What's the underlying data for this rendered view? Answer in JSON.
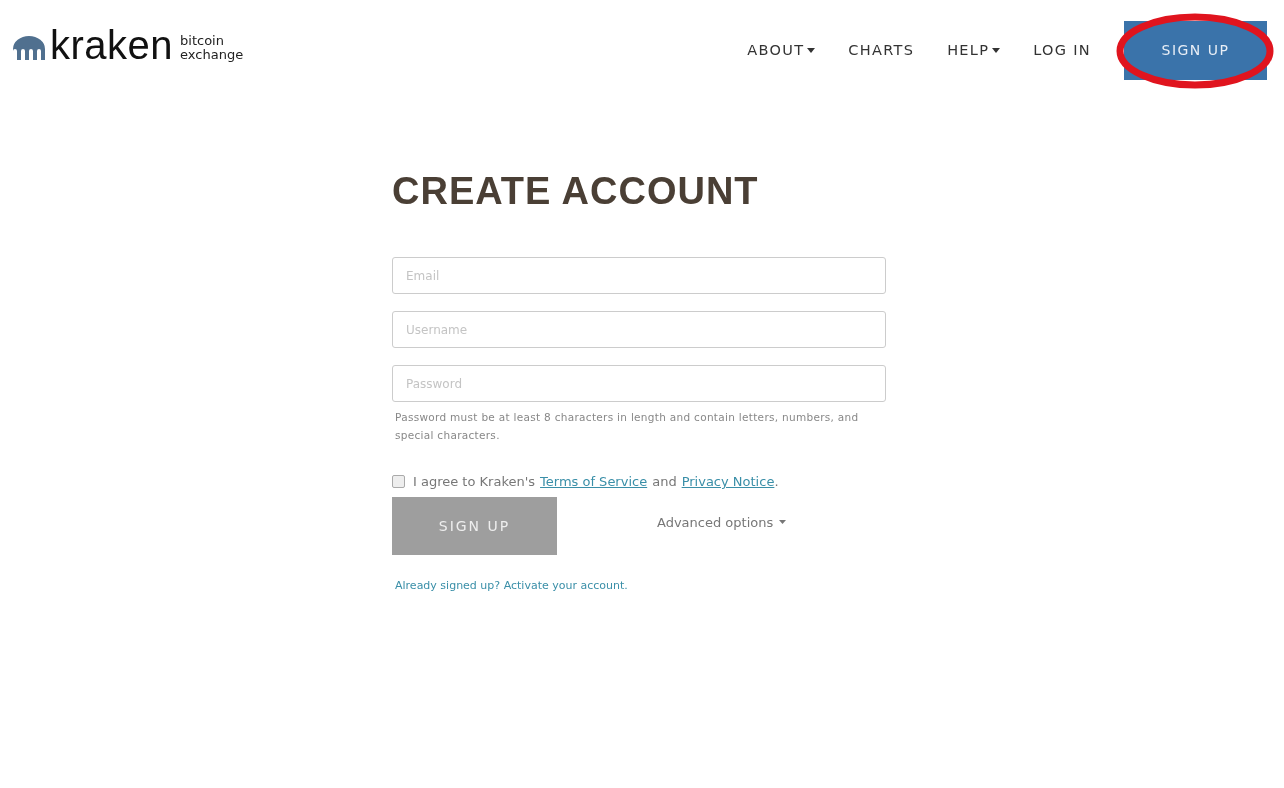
{
  "logo": {
    "name": "kraken",
    "tagline_1": "bitcoin",
    "tagline_2": "exchange"
  },
  "nav": [
    {
      "label": "ABOUT",
      "has_menu": true
    },
    {
      "label": "CHARTS",
      "has_menu": false
    },
    {
      "label": "HELP",
      "has_menu": true
    },
    {
      "label": "LOG IN",
      "has_menu": false
    }
  ],
  "signup_button": {
    "label": "SIGN UP",
    "circled": true
  },
  "form": {
    "title": "CREATE ACCOUNT",
    "fields": [
      {
        "placeholder": "Email"
      },
      {
        "placeholder": "Username"
      },
      {
        "placeholder": "Password"
      }
    ],
    "password_hint": "Password must be at least 8 characters in length and contain letters, numbers, and special characters.",
    "agree": {
      "checked": false,
      "before": "I agree to Kraken's",
      "terms": "Terms of Service",
      "middle": "and",
      "privacy": "Privacy Notice",
      "after": "."
    },
    "submit": {
      "label": "SIGN UP",
      "disabled": true
    },
    "advanced": "Advanced options",
    "activate": "Already signed up? Activate your account."
  }
}
